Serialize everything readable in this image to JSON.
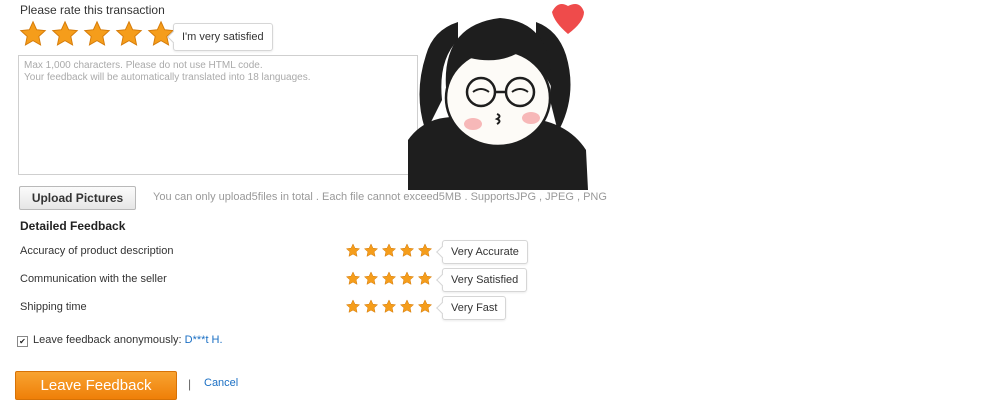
{
  "rating": {
    "prompt": "Please rate this transaction",
    "stars": 5,
    "max_stars": 5,
    "tooltip": "I'm very satisfied",
    "star_color": "#f59d1b"
  },
  "feedback_box": {
    "placeholder_line1": "Max 1,000 characters. Please do not use HTML code.",
    "placeholder_line2": "Your feedback will be automatically translated into 18 languages."
  },
  "upload": {
    "button_label": "Upload Pictures",
    "note": "You can only upload5files in total . Each file cannot exceed5MB . SupportsJPG , JPEG , PNG"
  },
  "detailed": {
    "title": "Detailed Feedback",
    "items": [
      {
        "label": "Accuracy of product description",
        "stars": 5,
        "tooltip": "Very Accurate"
      },
      {
        "label": "Communication with the seller",
        "stars": 5,
        "tooltip": "Very Satisfied"
      },
      {
        "label": "Shipping time",
        "stars": 5,
        "tooltip": "Very Fast"
      }
    ]
  },
  "anonymous": {
    "checked": true,
    "label": "Leave feedback anonymously: ",
    "username": "D***t H."
  },
  "actions": {
    "submit_label": "Leave Feedback",
    "separator": "|",
    "cancel_label": "Cancel",
    "submit_color": "#f39223",
    "link_color": "#1a6fc4"
  }
}
